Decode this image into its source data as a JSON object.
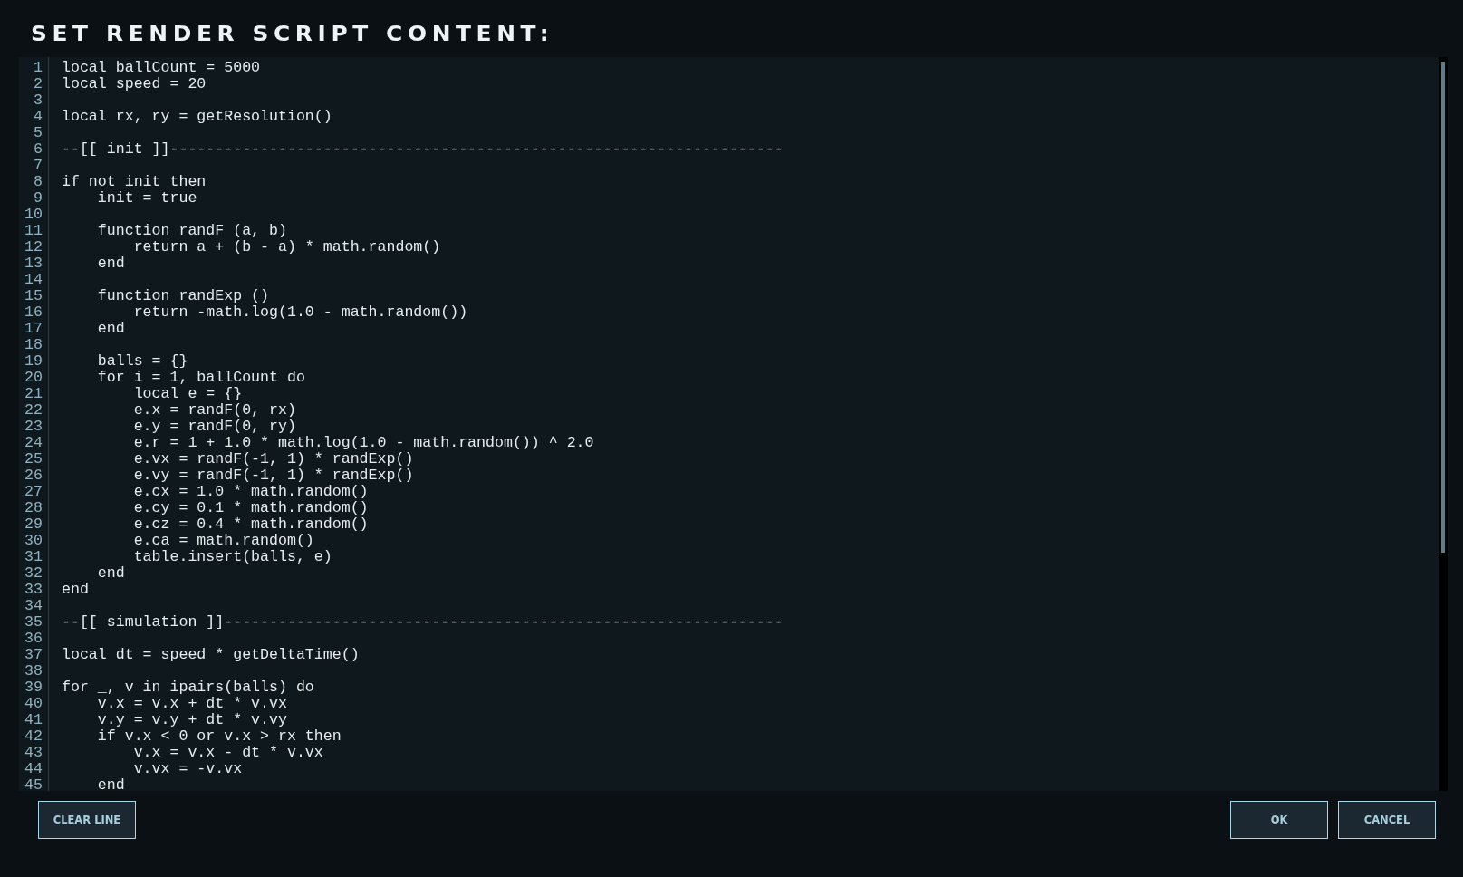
{
  "dialog": {
    "title": "SET RENDER SCRIPT CONTENT:"
  },
  "editor": {
    "lines": [
      {
        "number": "1",
        "text": "local ballCount = 5000"
      },
      {
        "number": "2",
        "text": "local speed = 20"
      },
      {
        "number": "3"
      },
      {
        "number": "4",
        "text": "local rx, ry = getResolution()"
      },
      {
        "number": "5"
      },
      {
        "number": "6",
        "text": "--[[ init ]]--------------------------------------------------------------------"
      },
      {
        "number": "7"
      },
      {
        "number": "8",
        "text": "if not init then"
      },
      {
        "number": "9",
        "text": "    init = true"
      },
      {
        "number": "10"
      },
      {
        "number": "11",
        "text": "    function randF (a, b)"
      },
      {
        "number": "12",
        "text": "        return a + (b - a) * math.random()"
      },
      {
        "number": "13",
        "text": "    end"
      },
      {
        "number": "14"
      },
      {
        "number": "15",
        "text": "    function randExp ()"
      },
      {
        "number": "16",
        "text": "        return -math.log(1.0 - math.random())"
      },
      {
        "number": "17",
        "text": "    end"
      },
      {
        "number": "18"
      },
      {
        "number": "19",
        "text": "    balls = {}"
      },
      {
        "number": "20",
        "text": "    for i = 1, ballCount do"
      },
      {
        "number": "21",
        "text": "        local e = {}"
      },
      {
        "number": "22",
        "text": "        e.x = randF(0, rx)"
      },
      {
        "number": "23",
        "text": "        e.y = randF(0, ry)"
      },
      {
        "number": "24",
        "text": "        e.r = 1 + 1.0 * math.log(1.0 - math.random()) ^ 2.0"
      },
      {
        "number": "25",
        "text": "        e.vx = randF(-1, 1) * randExp()"
      },
      {
        "number": "26",
        "text": "        e.vy = randF(-1, 1) * randExp()"
      },
      {
        "number": "27",
        "text": "        e.cx = 1.0 * math.random()"
      },
      {
        "number": "28",
        "text": "        e.cy = 0.1 * math.random()"
      },
      {
        "number": "29",
        "text": "        e.cz = 0.4 * math.random()"
      },
      {
        "number": "30",
        "text": "        e.ca = math.random()"
      },
      {
        "number": "31",
        "text": "        table.insert(balls, e)"
      },
      {
        "number": "32",
        "text": "    end"
      },
      {
        "number": "33",
        "text": "end"
      },
      {
        "number": "34"
      },
      {
        "number": "35",
        "text": "--[[ simulation ]]--------------------------------------------------------------"
      },
      {
        "number": "36"
      },
      {
        "number": "37",
        "text": "local dt = speed * getDeltaTime()"
      },
      {
        "number": "38"
      },
      {
        "number": "39",
        "text": "for _, v in ipairs(balls) do"
      },
      {
        "number": "40",
        "text": "    v.x = v.x + dt * v.vx"
      },
      {
        "number": "41",
        "text": "    v.y = v.y + dt * v.vy"
      },
      {
        "number": "42",
        "text": "    if v.x < 0 or v.x > rx then"
      },
      {
        "number": "43",
        "text": "        v.x = v.x - dt * v.vx"
      },
      {
        "number": "44",
        "text": "        v.vx = -v.vx"
      },
      {
        "number": "45",
        "text": "    end"
      }
    ]
  },
  "buttons": {
    "left": [
      "CLEAR LINE"
    ],
    "right": [
      "OK",
      "CANCEL"
    ]
  }
}
